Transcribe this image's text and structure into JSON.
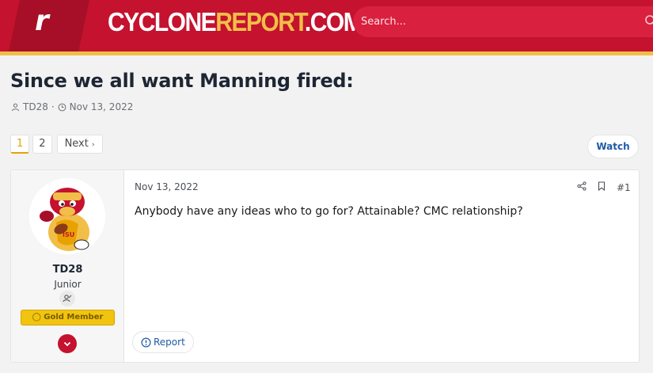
{
  "header": {
    "logo_mark": "r",
    "logo_primary": "CYCLONE",
    "logo_accent": "REPORT",
    "logo_suffix": ".COM",
    "search_placeholder": "Search...",
    "brand_red": "#c4122f",
    "brand_gold": "#f1be48"
  },
  "thread": {
    "title": "Since we all want Manning fired:",
    "author": "TD28",
    "separator": "·",
    "date": "Nov 13, 2022"
  },
  "pagination": {
    "pages": [
      "1",
      "2"
    ],
    "current": "1",
    "next_label": "Next",
    "next_icon": "chevron-right-icon"
  },
  "watch_label": "Watch",
  "post": {
    "user": {
      "name": "TD28",
      "title": "Junior",
      "banner": "Gold Member",
      "avatar_icon": "cy-mascot-avatar"
    },
    "date": "Nov 13, 2022",
    "number": "#1",
    "body": "Anybody have any ideas who to go for? Attainable? CMC relationship?",
    "report_label": "Report"
  }
}
